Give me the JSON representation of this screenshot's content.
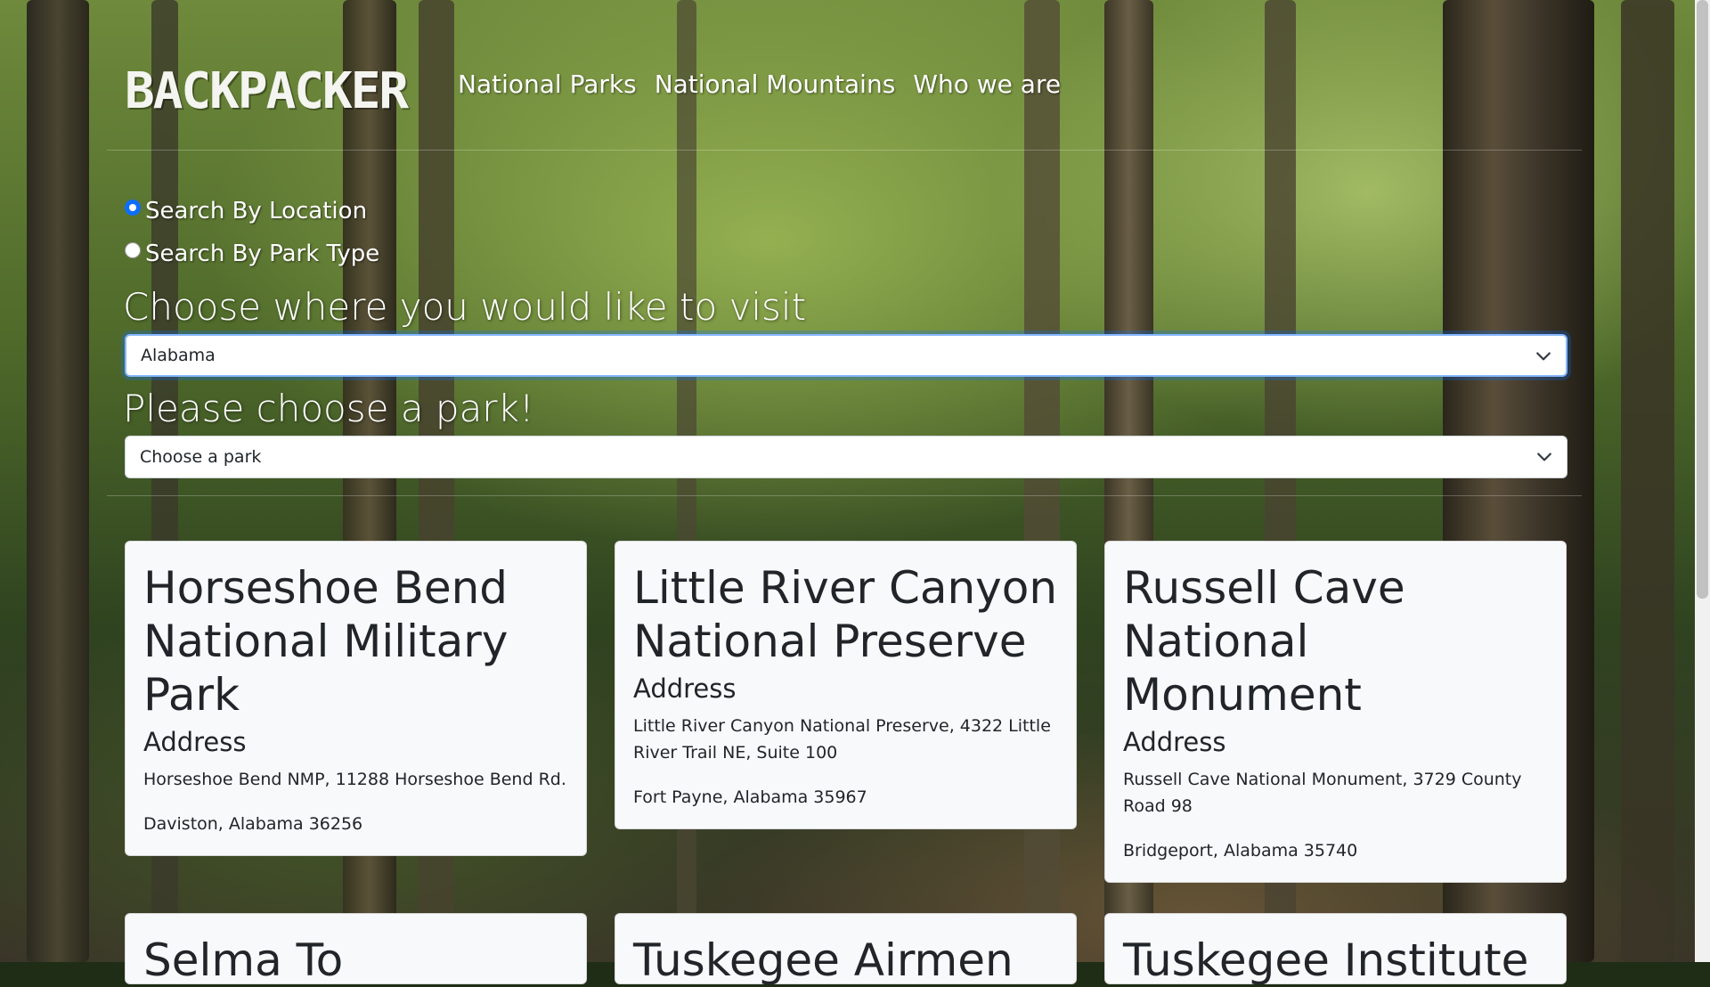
{
  "brand": "BACKPACKER",
  "nav": {
    "links": [
      "National Parks",
      "National Mountains",
      "Who we are"
    ]
  },
  "search": {
    "options": [
      {
        "label": "Search By Location",
        "checked": true
      },
      {
        "label": "Search By Park Type",
        "checked": false
      }
    ],
    "location_label": "Choose where you would like to visit",
    "location_value": "Alabama",
    "park_label": "Please choose a park!",
    "park_value": "Choose a park"
  },
  "cards": [
    {
      "title": "Horseshoe Bend National Military Park",
      "subtitle": "Address",
      "line1": "Horseshoe Bend NMP, 11288 Horseshoe Bend Rd.",
      "line2": "Daviston, Alabama 36256"
    },
    {
      "title": "Little River Canyon National Preserve",
      "subtitle": "Address",
      "line1": "Little River Canyon National Preserve, 4322 Little River Trail NE, Suite 100",
      "line2": "Fort Payne, Alabama 35967"
    },
    {
      "title": "Russell Cave National Monument",
      "subtitle": "Address",
      "line1": "Russell Cave National Monument, 3729 County Road 98",
      "line2": "Bridgeport, Alabama 35740"
    },
    {
      "title": "Selma To"
    },
    {
      "title": "Tuskegee Airmen"
    },
    {
      "title": "Tuskegee Institute"
    }
  ]
}
